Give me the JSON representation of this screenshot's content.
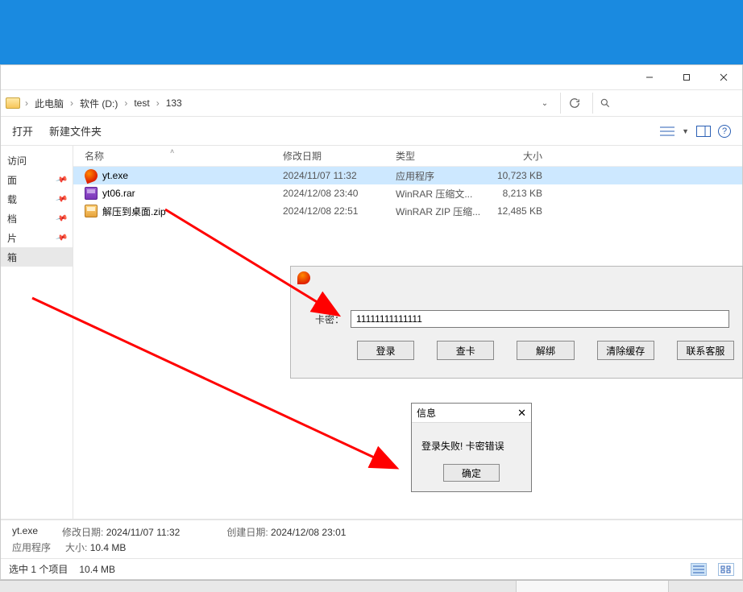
{
  "explorer": {
    "breadcrumb": [
      "此电脑",
      "软件 (D:)",
      "test",
      "133"
    ],
    "toolbar": {
      "open": "打开",
      "new_folder": "新建文件夹"
    },
    "columns": {
      "name": "名称",
      "modified": "修改日期",
      "type": "类型",
      "size": "大小"
    },
    "sidebar": {
      "items": [
        "访问",
        "面",
        "载",
        "档",
        "片",
        "箱"
      ]
    },
    "files": [
      {
        "icon": "flame",
        "name": "yt.exe",
        "modified": "2024/11/07 11:32",
        "type": "应用程序",
        "size": "10,723 KB",
        "selected": true
      },
      {
        "icon": "rar",
        "name": "yt06.rar",
        "modified": "2024/12/08 23:40",
        "type": "WinRAR 压缩文...",
        "size": "8,213 KB",
        "selected": false
      },
      {
        "icon": "zip",
        "name": "解压到桌面.zip",
        "modified": "2024/12/08 22:51",
        "type": "WinRAR ZIP 压缩...",
        "size": "12,485 KB",
        "selected": false
      }
    ],
    "details": {
      "name": "yt.exe",
      "modified_label": "修改日期:",
      "modified": "2024/11/07 11:32",
      "created_label": "创建日期:",
      "created": "2024/12/08 23:01",
      "type_label": "应用程序",
      "size_label": "大小:",
      "size": "10.4 MB"
    },
    "status": {
      "selection": "选中 1 个项目",
      "size": "10.4 MB"
    }
  },
  "login": {
    "label": "卡密：",
    "value": "11111111111111",
    "buttons": {
      "login": "登录",
      "check": "查卡",
      "unbind": "解绑",
      "clear": "清除缓存",
      "contact": "联系客服"
    }
  },
  "msg": {
    "title": "信息",
    "body": "登录失败! 卡密错误",
    "ok": "确定"
  }
}
